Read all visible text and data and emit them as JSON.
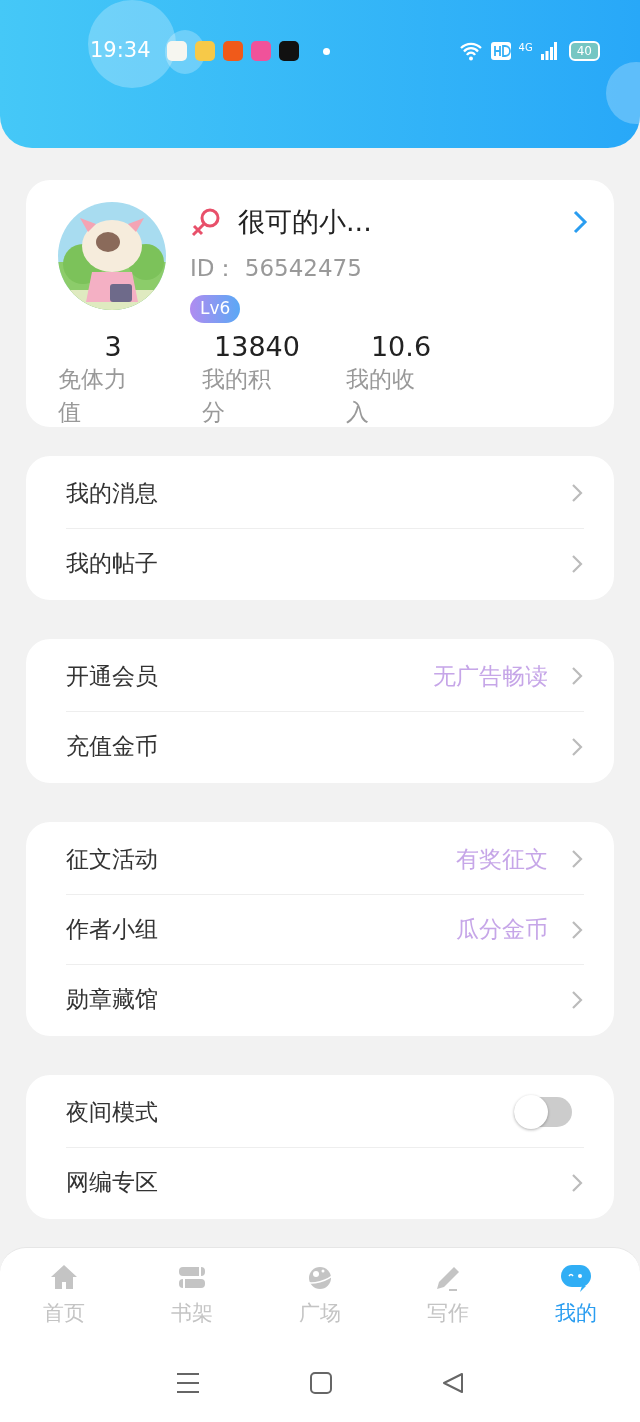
{
  "status_bar": {
    "time": "19:34",
    "notifications": [
      {
        "color": "#f6f6f0"
      },
      {
        "color": "#f7c948"
      },
      {
        "color": "#f05a1a"
      },
      {
        "color": "#f0529a"
      },
      {
        "color": "#111111"
      }
    ],
    "network": "4G",
    "battery": "40"
  },
  "profile": {
    "name": "很可的小...",
    "id": "ID：  56542475",
    "level": "Lv6",
    "stats": [
      {
        "value": "3",
        "label": "免体力值"
      },
      {
        "value": "13840",
        "label": "我的积分"
      },
      {
        "value": "10.6",
        "label": "我的收入"
      }
    ]
  },
  "groups": [
    {
      "items": [
        {
          "kind": "link",
          "label": "我的消息"
        },
        {
          "kind": "link",
          "label": "我的帖子"
        }
      ]
    },
    {
      "items": [
        {
          "kind": "link",
          "label": "开通会员",
          "hint": "无广告畅读"
        },
        {
          "kind": "link",
          "label": "充值金币"
        }
      ]
    },
    {
      "items": [
        {
          "kind": "link",
          "label": "征文活动",
          "hint": "有奖征文"
        },
        {
          "kind": "link",
          "label": "作者小组",
          "hint": "瓜分金币"
        },
        {
          "kind": "link",
          "label": "勋章藏馆"
        }
      ]
    },
    {
      "items": [
        {
          "kind": "toggle",
          "label": "夜间模式",
          "on": false
        },
        {
          "kind": "link",
          "label": "网编专区"
        }
      ]
    }
  ],
  "tabs": [
    {
      "label": "首页",
      "selected": false
    },
    {
      "label": "书架",
      "selected": false
    },
    {
      "label": "广场",
      "selected": false
    },
    {
      "label": "写作",
      "selected": false
    },
    {
      "label": "我的",
      "selected": true
    }
  ]
}
